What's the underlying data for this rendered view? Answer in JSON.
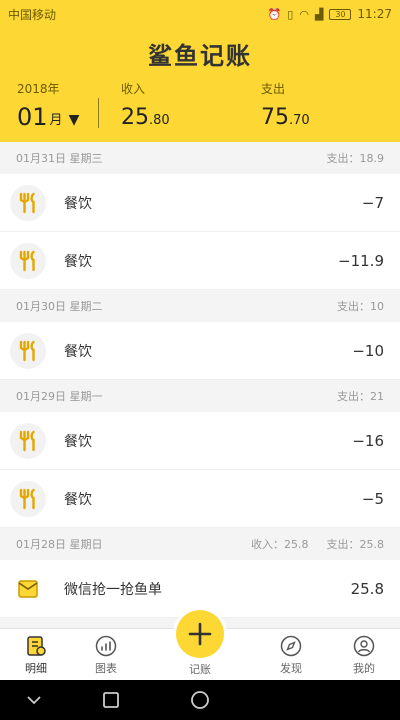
{
  "status": {
    "carrier": "中国移动",
    "battery": "30",
    "time": "11:27"
  },
  "app": {
    "title": "鲨鱼记账"
  },
  "summary": {
    "year": "2018年",
    "month": "01",
    "month_unit": "月",
    "income_label": "收入",
    "income_int": "25",
    "income_dec": ".80",
    "expense_label": "支出",
    "expense_int": "75",
    "expense_dec": ".70"
  },
  "days": [
    {
      "date": "01月31日 星期三",
      "expense": "支出：18.9",
      "records": [
        {
          "label": "餐饮",
          "amount": "−7"
        },
        {
          "label": "餐饮",
          "amount": "−11.9"
        }
      ]
    },
    {
      "date": "01月30日 星期二",
      "expense": "支出：10",
      "records": [
        {
          "label": "餐饮",
          "amount": "−10"
        }
      ]
    },
    {
      "date": "01月29日 星期一",
      "expense": "支出：21",
      "records": [
        {
          "label": "餐饮",
          "amount": "−16"
        },
        {
          "label": "餐饮",
          "amount": "−5"
        }
      ]
    },
    {
      "date": "01月28日 星期日",
      "income": "收入：25.8",
      "expense": "支出：25.8",
      "records": [
        {
          "label": "微信抢一抢鱼单",
          "amount": "25.8"
        }
      ]
    }
  ],
  "tabs": {
    "detail": "明细",
    "chart": "图表",
    "add": "记账",
    "discover": "发现",
    "mine": "我的"
  },
  "colors": {
    "accent": "#fdd835",
    "bg": "#f4f4f4"
  },
  "icons": {
    "category": "fork-spoon-icon",
    "envelope": "envelope-icon"
  }
}
